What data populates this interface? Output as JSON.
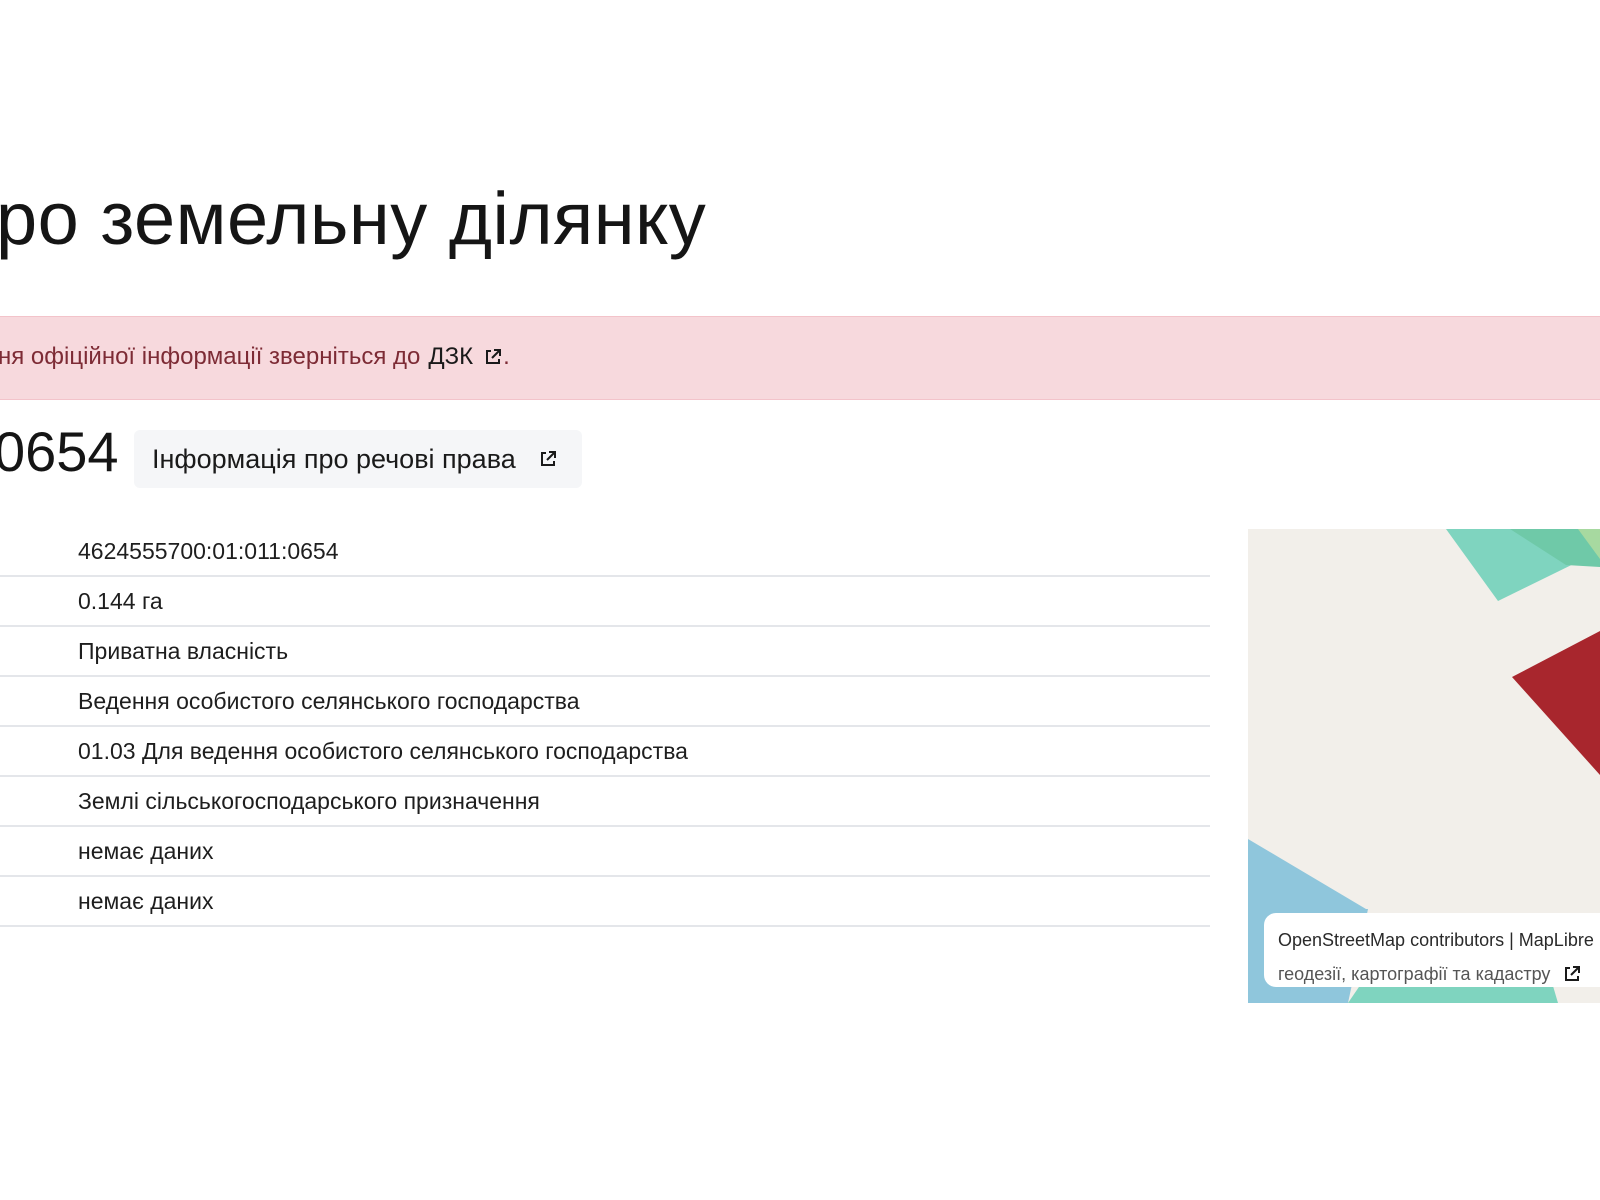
{
  "page": {
    "title": "ро земельну ділянку"
  },
  "notice": {
    "text": "ня офіційної інформації зверніться до",
    "link_label": "ДЗК",
    "trailing": "."
  },
  "parcel": {
    "number_fragment": "0654",
    "rights_button_label": "Інформація про речові права"
  },
  "info_rows": [
    {
      "value": "4624555700:01:011:0654"
    },
    {
      "value": "0.144 га"
    },
    {
      "value": "Приватна власність"
    },
    {
      "value": "Ведення особистого селянського господарства"
    },
    {
      "value": "01.03 Для ведення особистого селянського господарства"
    },
    {
      "value": "Землі сільськогосподарського призначення"
    },
    {
      "value": "немає даних"
    },
    {
      "value": "немає даних"
    }
  ],
  "map": {
    "attribution_line1": "OpenStreetMap contributors | MapLibre",
    "attribution_line2": "геодезії, картографії та кадастру",
    "colors": {
      "background": "#f2efea",
      "parcel_highlight": "#a8262d",
      "teal": "#7fd4bf",
      "green": "#a7d9a0",
      "blue": "#8fc6dc"
    }
  },
  "icons": {
    "external_link": "external-link-icon"
  },
  "colors": {
    "notice_bg": "#f7d9dd",
    "notice_text": "#7d2b35",
    "button_bg": "#f5f6f8",
    "row_divider": "#e4e6ea"
  }
}
